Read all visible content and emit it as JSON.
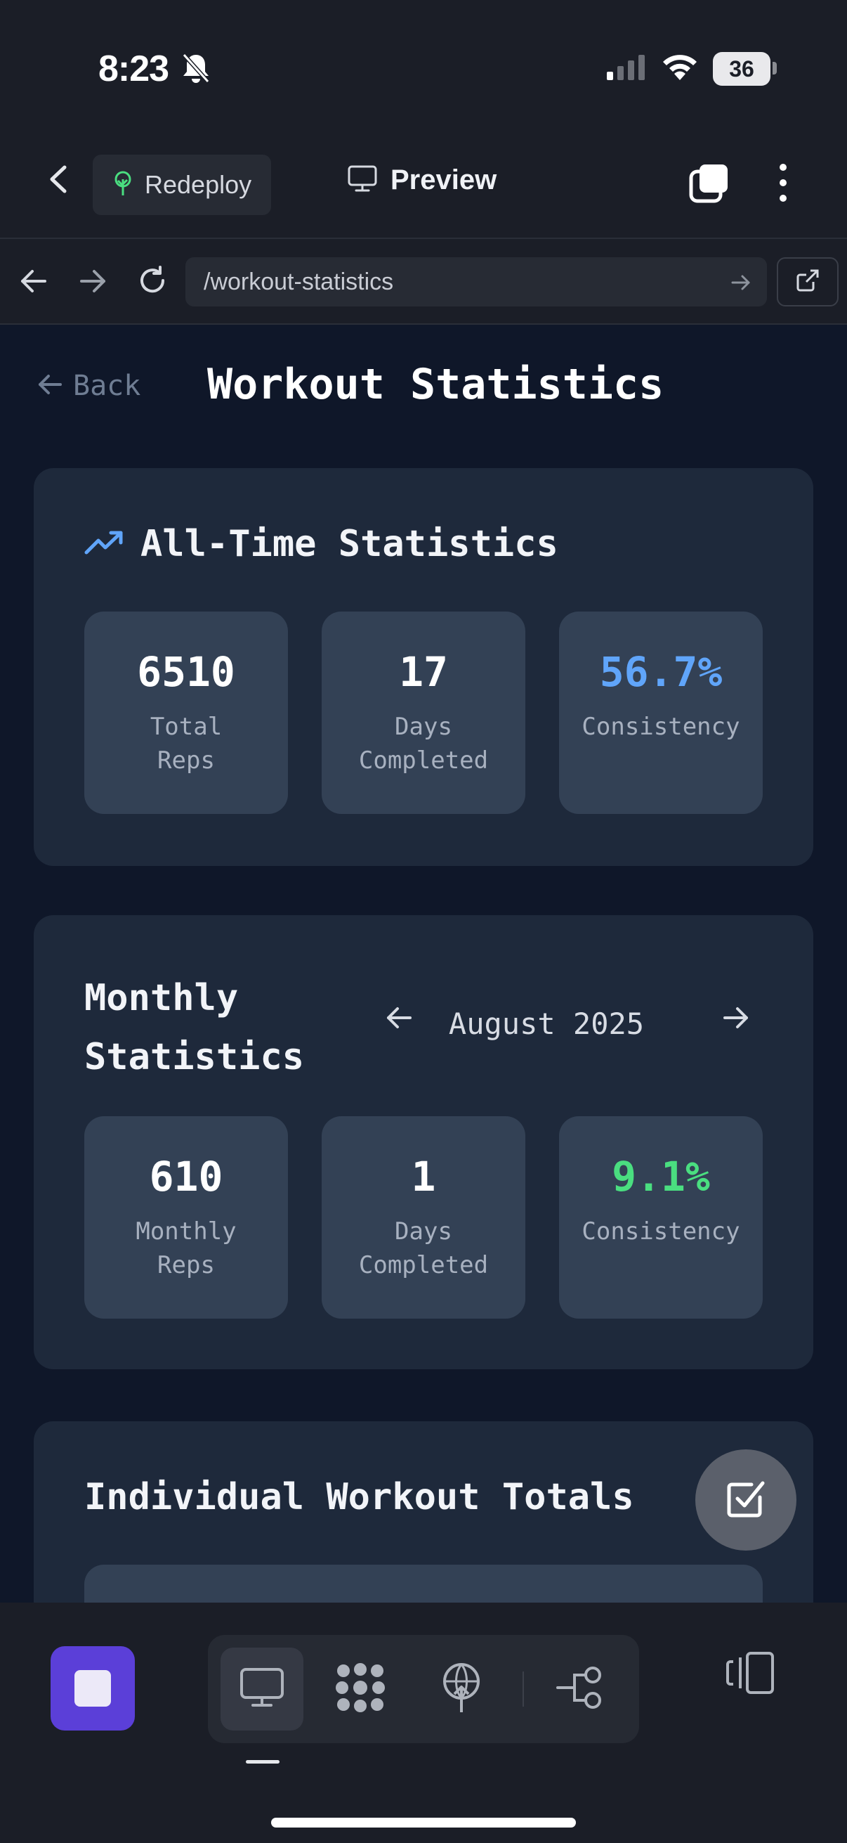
{
  "status_bar": {
    "time": "8:23",
    "battery": "36"
  },
  "toolbar": {
    "redeploy_label": "Redeploy",
    "preview_label": "Preview"
  },
  "url_bar": {
    "url": "/workout-statistics"
  },
  "page": {
    "back_label": "Back",
    "title": "Workout Statistics",
    "all_time": {
      "heading": "All-Time Statistics",
      "stats": [
        {
          "value": "6510",
          "label": "Total\nReps"
        },
        {
          "value": "17",
          "label": "Days\nCompleted"
        },
        {
          "value": "56.7%",
          "label": "Consistency"
        }
      ]
    },
    "monthly": {
      "heading": "Monthly Statistics",
      "month": "August 2025",
      "stats": [
        {
          "value": "610",
          "label": "Monthly\nReps"
        },
        {
          "value": "1",
          "label": "Days\nCompleted"
        },
        {
          "value": "9.1%",
          "label": "Consistency"
        }
      ]
    },
    "individual": {
      "heading": "Individual Workout Totals"
    }
  },
  "colors": {
    "accent_blue": "#60a5fa",
    "accent_green": "#4ade80",
    "stop_button": "#5b3fd8"
  },
  "icons": {
    "status": [
      "bell-slash-icon",
      "cellular-signal-icon",
      "wifi-icon",
      "battery-icon"
    ],
    "toolbar": [
      "chevron-left-icon",
      "tree-icon",
      "monitor-icon",
      "tabs-icon",
      "more-vertical-icon"
    ],
    "bottom": [
      "stop-icon",
      "monitor-icon",
      "cluster-icon",
      "deploy-icon",
      "flow-icon",
      "device-toggle-icon"
    ]
  }
}
